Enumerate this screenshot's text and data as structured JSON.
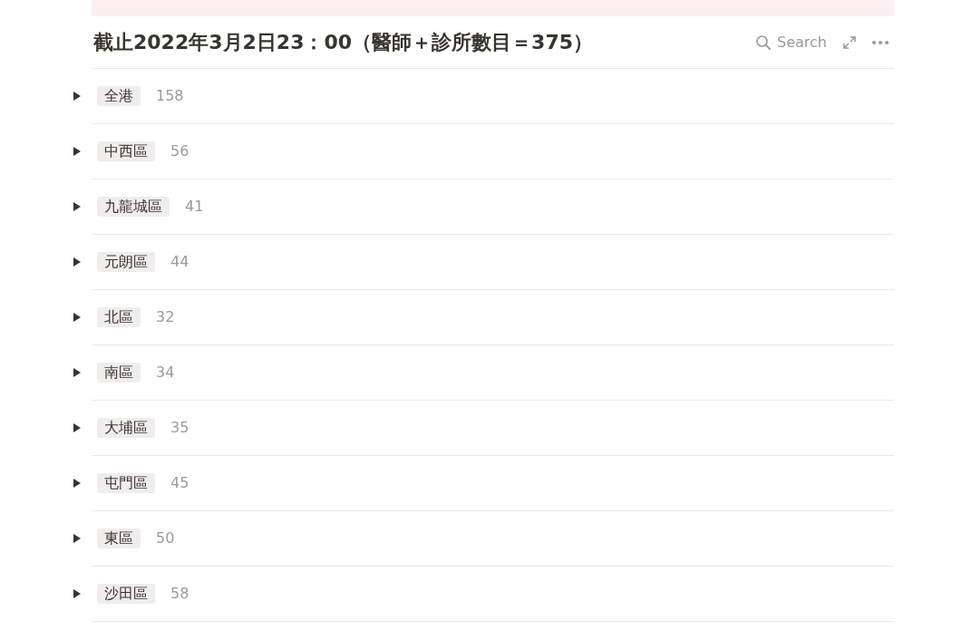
{
  "title": "截止2022年3月2日23：00（醫師＋診所數目＝375）",
  "toolbar": {
    "search": "Search"
  },
  "groups": [
    {
      "label": "全港",
      "count": "158",
      "expanded": false
    },
    {
      "label": "中西區",
      "count": "56",
      "expanded": false
    },
    {
      "label": "九龍城區",
      "count": "41",
      "expanded": false
    },
    {
      "label": "元朗區",
      "count": "44",
      "expanded": false
    },
    {
      "label": "北區",
      "count": "32",
      "expanded": false
    },
    {
      "label": "南區",
      "count": "34",
      "expanded": false
    },
    {
      "label": "大埔區",
      "count": "35",
      "expanded": false
    },
    {
      "label": "屯門區",
      "count": "45",
      "expanded": false
    },
    {
      "label": "東區",
      "count": "50",
      "expanded": false
    },
    {
      "label": "沙田區",
      "count": "58",
      "expanded": false
    }
  ]
}
